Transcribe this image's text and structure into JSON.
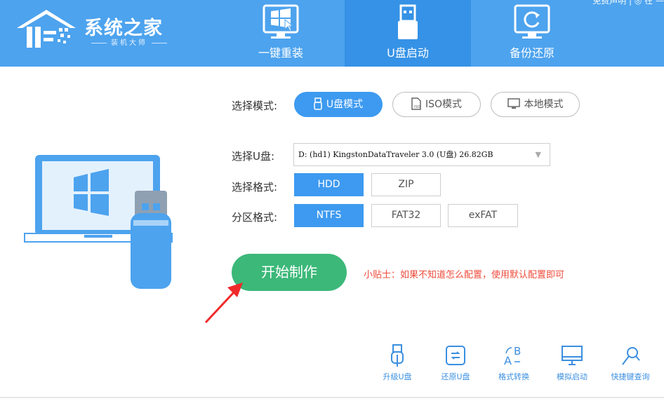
{
  "app": {
    "brand_name": "系统之家",
    "brand_sub": "装机大师",
    "top_links": "免费声明 | ◎ 在 —"
  },
  "nav": {
    "tabs": [
      {
        "label": "一键重装",
        "icon": "windows-monitor-icon"
      },
      {
        "label": "U盘启动",
        "icon": "usb-drive-icon",
        "active": true
      },
      {
        "label": "备份还原",
        "icon": "backup-monitor-icon"
      }
    ]
  },
  "mode": {
    "label": "选择模式:",
    "options": [
      {
        "label": "U盘模式",
        "icon": "usb-icon",
        "active": true
      },
      {
        "label": "ISO模式",
        "icon": "iso-file-icon",
        "active": false
      },
      {
        "label": "本地模式",
        "icon": "monitor-icon",
        "active": false
      }
    ]
  },
  "usb_select": {
    "label": "选择U盘:",
    "value": "D: (hd1) KingstonDataTraveler 3.0 (U盘) 26.82GB"
  },
  "format": {
    "label": "选择格式:",
    "options": [
      "HDD",
      "ZIP"
    ],
    "selected": "HDD"
  },
  "partition": {
    "label": "分区格式:",
    "options": [
      "NTFS",
      "FAT32",
      "exFAT"
    ],
    "selected": "NTFS"
  },
  "start_label": "开始制作",
  "tip": "小贴士：如果不知道怎么配置，使用默认配置即可",
  "tools": [
    {
      "label": "升级U盘",
      "icon": "usb-upgrade-icon"
    },
    {
      "label": "还原U盘",
      "icon": "restore-icon"
    },
    {
      "label": "格式转换",
      "icon": "format-convert-icon"
    },
    {
      "label": "模拟启动",
      "icon": "monitor-icon"
    },
    {
      "label": "快捷键查询",
      "icon": "search-key-icon"
    }
  ],
  "colors": {
    "header": "#4da3ee",
    "active_tab": "#3592e6",
    "accent": "#3d9af0",
    "start": "#3cb879",
    "tip": "#ee4b3b"
  }
}
